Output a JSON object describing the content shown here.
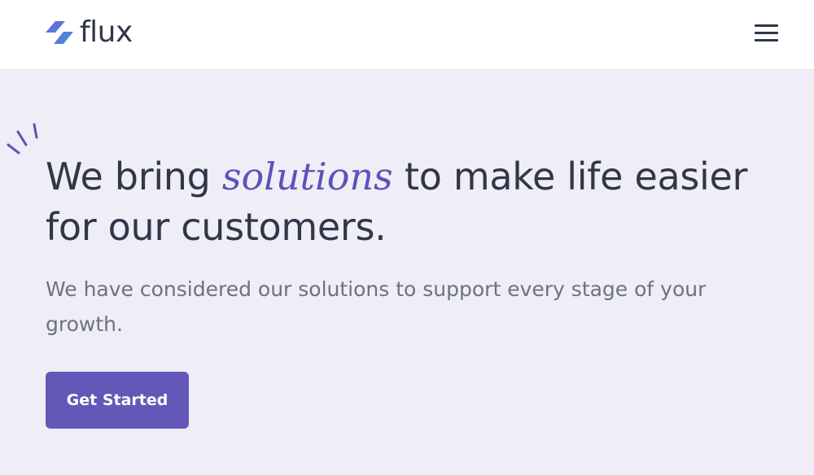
{
  "header": {
    "brand": "flux",
    "logo_icon": "flux-bolt-logo-icon",
    "menu_icon": "hamburger-menu-icon"
  },
  "hero": {
    "headline_before": "We bring ",
    "headline_accent": "solutions",
    "headline_after": " to make life easier for our customers.",
    "subtext": "We have considered our solutions to support every stage of your growth.",
    "cta_label": "Get Started",
    "decoration_icon": "sparkle-lines-icon"
  },
  "colors": {
    "brand": "#6357b8",
    "accent_text": "#5b53b8",
    "heading": "#2f3748",
    "body_text": "#6b7281",
    "background": "#efeef7",
    "header_bg": "#ffffff"
  }
}
